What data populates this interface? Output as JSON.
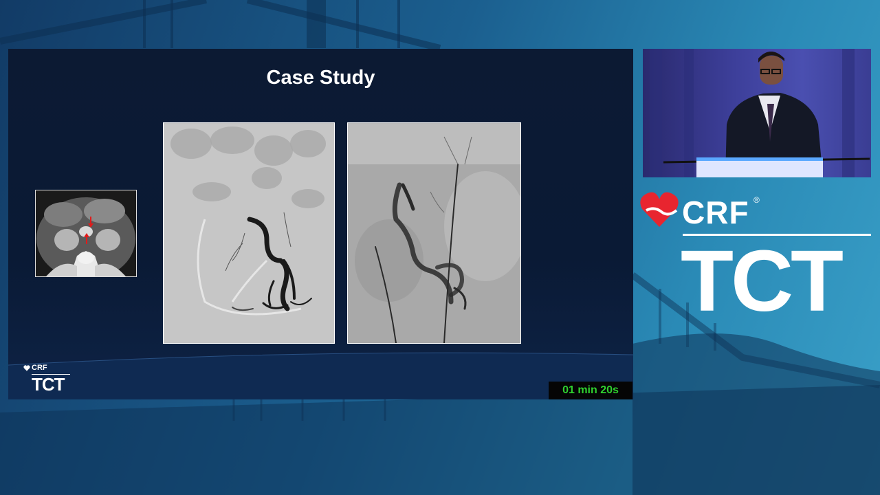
{
  "slide": {
    "title": "Case Study",
    "logo_crf": "CRF",
    "logo_tct": "TCT",
    "timer": "01 min 20s"
  },
  "branding": {
    "crf": "CRF",
    "registered": "®",
    "tct": "TCT"
  },
  "colors": {
    "timer_text": "#2fd12f",
    "heart_red": "#e8252f",
    "background_blue": "#1b5f8f"
  },
  "icons": {
    "brand_logo": "heart-icon",
    "ct_arrows": "arrow-icon"
  }
}
